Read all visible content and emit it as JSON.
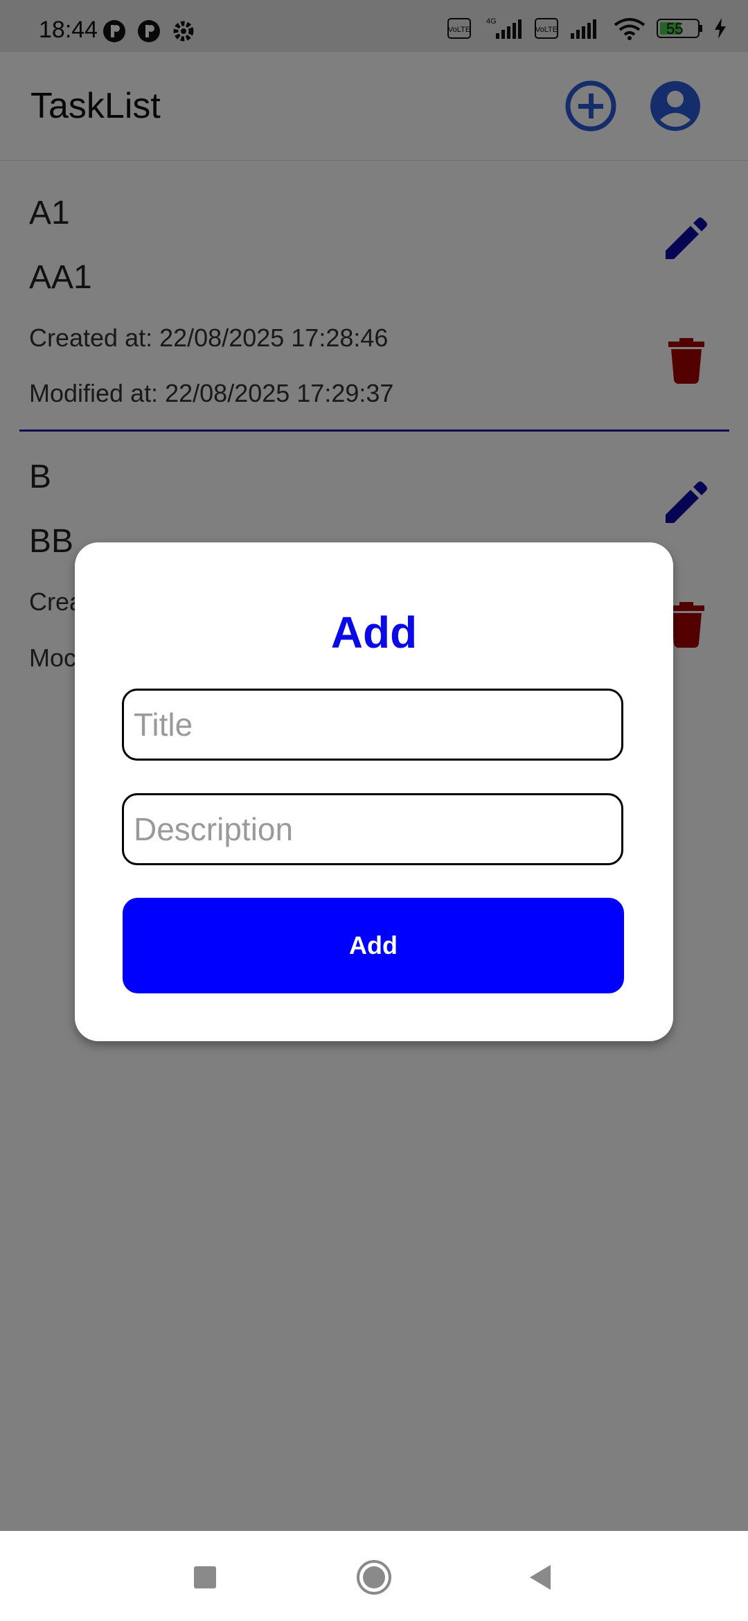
{
  "status": {
    "time": "18:44",
    "battery": "55",
    "network": "4G"
  },
  "header": {
    "title": "TaskList",
    "add_icon": "add-circle-icon",
    "profile_icon": "account-circle-icon"
  },
  "tasks": [
    {
      "title": "A1",
      "description": "AA1",
      "created": "Created at: 22/08/2025 17:28:46",
      "modified": "Modified at: 22/08/2025 17:29:37"
    },
    {
      "title": "B",
      "description": "BB",
      "created": "Crea",
      "modified": "Moc"
    }
  ],
  "dialog": {
    "title": "Add",
    "title_placeholder": "Title",
    "description_placeholder": "Description",
    "submit_label": "Add"
  },
  "colors": {
    "accent_blue": "#0000ff",
    "edit_icon": "#0a0aa8",
    "delete_icon": "#a60000",
    "header_icon": "#2d5bd6"
  }
}
